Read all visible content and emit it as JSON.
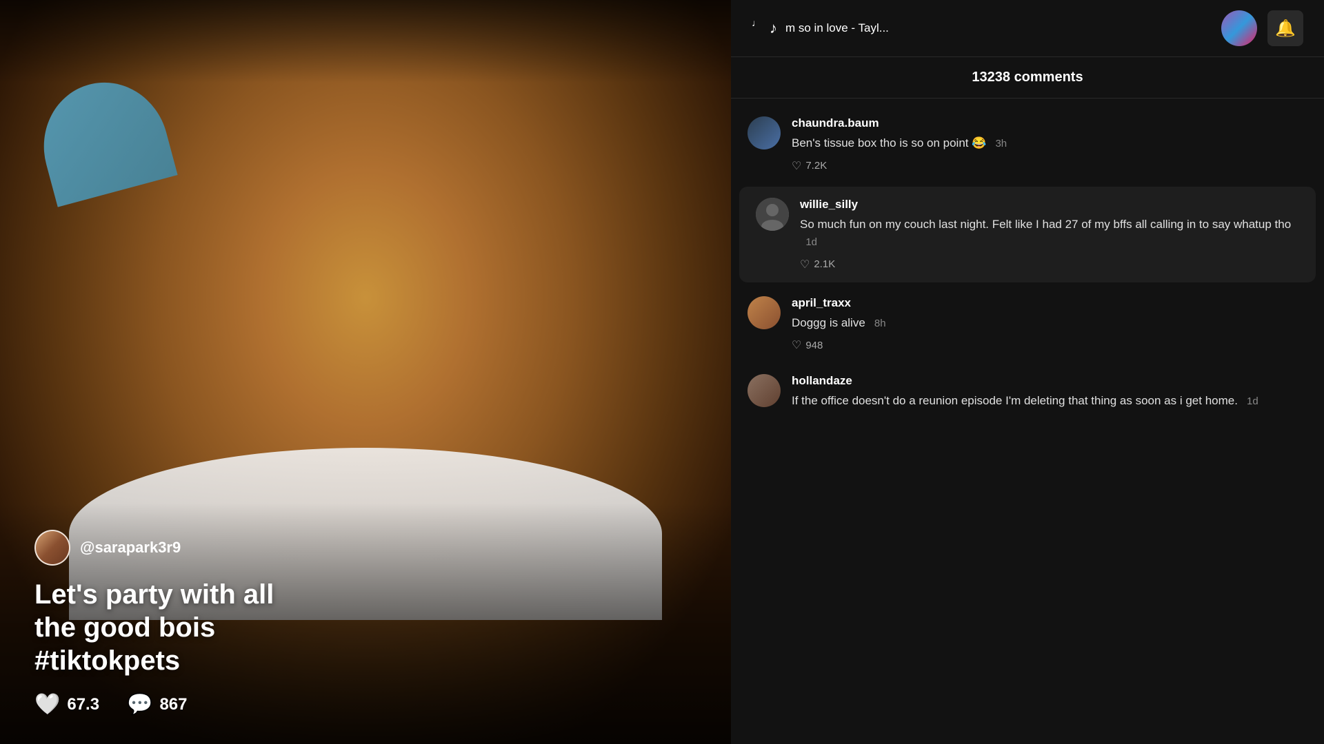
{
  "video": {
    "username": "@sarapark3r9",
    "caption": "Let's party with all\nthe good bois\n#tiktokpets",
    "likes": "67.3",
    "comments": "867"
  },
  "header": {
    "music_text": "m so in love - Tayl...",
    "bell_icon": "🔔",
    "music_note": "♪"
  },
  "comments_section": {
    "count": "13238 comments",
    "comments": [
      {
        "id": 1,
        "username": "chaundra.baum",
        "text": "Ben's tissue box tho is so on point 😂",
        "time": "3h",
        "likes": "7.2K",
        "highlighted": false
      },
      {
        "id": 2,
        "username": "willie_silly",
        "text": "So much fun on my couch last night. Felt like I had 27 of my bffs all calling in to say whatup tho",
        "time": "1d",
        "likes": "2.1K",
        "highlighted": true
      },
      {
        "id": 3,
        "username": "april_traxx",
        "text": "Doggg is alive",
        "time": "8h",
        "likes": "948",
        "highlighted": false
      },
      {
        "id": 4,
        "username": "hollandaze",
        "text": "If the office doesn't do a reunion episode I'm deleting that thing as soon as i get home.",
        "time": "1d",
        "likes": "",
        "highlighted": false
      }
    ]
  }
}
